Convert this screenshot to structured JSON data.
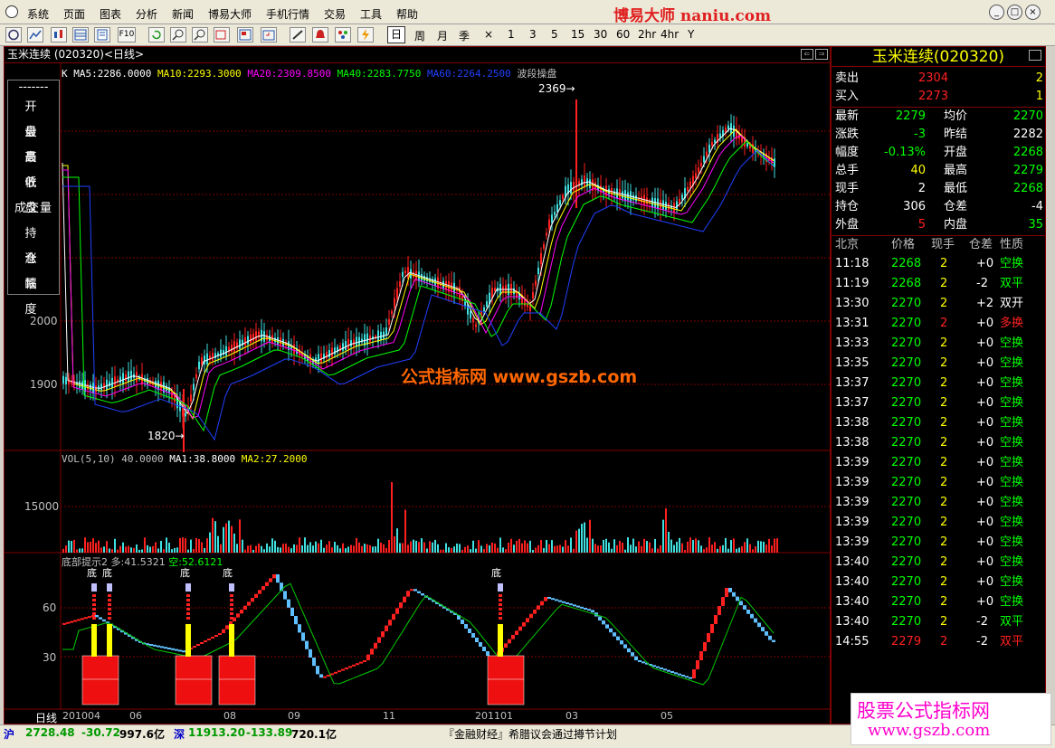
{
  "menu": [
    "系统",
    "页面",
    "图表",
    "分析",
    "新闻",
    "博易大师",
    "手机行情",
    "交易",
    "工具",
    "帮助"
  ],
  "brand": "博易大师 naniu.com",
  "periods": [
    "日",
    "周",
    "月",
    "季",
    "×",
    "1",
    "3",
    "5",
    "15",
    "30",
    "60",
    "2hr",
    "4hr",
    "Y"
  ],
  "chart_title": "玉米连续 (020320)<日线>",
  "ma_legend": {
    "k": "K",
    "ma5": "MA5:2286.0000",
    "ma10": "MA10:2293.3000",
    "ma20": "MA20:2309.8500",
    "ma40": "MA40:2283.7750",
    "ma60": "MA60:2264.2500",
    "extra": "波段操盘"
  },
  "ohlc_labels": [
    "-------",
    "开　盘",
    "最　高",
    "最　低",
    "收　盘",
    "成交量",
    "持　仓",
    "涨　跌",
    "幅　度"
  ],
  "price_axis": [
    "2000",
    "1900"
  ],
  "price_marks": {
    "high": "2369",
    "low": "1820"
  },
  "vol_legend": {
    "vol": "VOL(5,10) 40.0000",
    "ma1": "MA1:38.8000",
    "ma2": "MA2:27.2000"
  },
  "vol_axis": "15000",
  "ind_legend": {
    "name": "底部提示2",
    "duo": "多:41.5321",
    "kong": "空:52.6121"
  },
  "ind_axis": [
    "60",
    "30"
  ],
  "bottom_marks": [
    "底",
    "底",
    "底",
    "底",
    "底"
  ],
  "x_labels": [
    "日线",
    "201004",
    "06",
    "08",
    "09",
    "11",
    "201101",
    "03",
    "05"
  ],
  "watermark": "公式指标网 www.gszb.com",
  "watermark2": {
    "line1": "股票公式指标网",
    "line2": "www.gszb.com"
  },
  "quote": {
    "title": "玉米连续(020320)",
    "sell": {
      "label": "卖出",
      "price": "2304",
      "vol": "2"
    },
    "buy": {
      "label": "买入",
      "price": "2273",
      "vol": "1"
    },
    "rows": [
      {
        "l1": "最新",
        "v1": "2279",
        "l2": "均价",
        "v2": "2270"
      },
      {
        "l1": "涨跌",
        "v1": "-3",
        "l2": "昨结",
        "v2": "2282"
      },
      {
        "l1": "幅度",
        "v1": "-0.13%",
        "l2": "开盘",
        "v2": "2268"
      },
      {
        "l1": "总手",
        "v1": "40",
        "l2": "最高",
        "v2": "2279"
      },
      {
        "l1": "现手",
        "v1": "2",
        "l2": "最低",
        "v2": "2268"
      },
      {
        "l1": "持仓",
        "v1": "306",
        "l2": "仓差",
        "v2": "-4"
      },
      {
        "l1": "外盘",
        "v1": "5",
        "l2": "内盘",
        "v2": "35"
      }
    ],
    "tick_header": [
      "北京",
      "价格",
      "现手",
      "仓差",
      "性质"
    ],
    "ticks": [
      {
        "t": "11:18",
        "p": "2268",
        "v": "2",
        "d": "+0",
        "n": "空换",
        "c": "g"
      },
      {
        "t": "11:19",
        "p": "2268",
        "v": "2",
        "d": "-2",
        "n": "双平",
        "c": "g"
      },
      {
        "t": "13:30",
        "p": "2270",
        "v": "2",
        "d": "+2",
        "n": "双开",
        "c": "w"
      },
      {
        "t": "13:31",
        "p": "2270",
        "v": "2",
        "d": "+0",
        "n": "多换",
        "c": "r"
      },
      {
        "t": "13:33",
        "p": "2270",
        "v": "2",
        "d": "+0",
        "n": "空换",
        "c": "g"
      },
      {
        "t": "13:35",
        "p": "2270",
        "v": "2",
        "d": "+0",
        "n": "空换",
        "c": "g"
      },
      {
        "t": "13:37",
        "p": "2270",
        "v": "2",
        "d": "+0",
        "n": "空换",
        "c": "g"
      },
      {
        "t": "13:37",
        "p": "2270",
        "v": "2",
        "d": "+0",
        "n": "空换",
        "c": "g"
      },
      {
        "t": "13:38",
        "p": "2270",
        "v": "2",
        "d": "+0",
        "n": "空换",
        "c": "g"
      },
      {
        "t": "13:38",
        "p": "2270",
        "v": "2",
        "d": "+0",
        "n": "空换",
        "c": "g"
      },
      {
        "t": "13:39",
        "p": "2270",
        "v": "2",
        "d": "+0",
        "n": "空换",
        "c": "g"
      },
      {
        "t": "13:39",
        "p": "2270",
        "v": "2",
        "d": "+0",
        "n": "空换",
        "c": "g"
      },
      {
        "t": "13:39",
        "p": "2270",
        "v": "2",
        "d": "+0",
        "n": "空换",
        "c": "g"
      },
      {
        "t": "13:39",
        "p": "2270",
        "v": "2",
        "d": "+0",
        "n": "空换",
        "c": "g"
      },
      {
        "t": "13:39",
        "p": "2270",
        "v": "2",
        "d": "+0",
        "n": "空换",
        "c": "g"
      },
      {
        "t": "13:40",
        "p": "2270",
        "v": "2",
        "d": "+0",
        "n": "空换",
        "c": "g"
      },
      {
        "t": "13:40",
        "p": "2270",
        "v": "2",
        "d": "+0",
        "n": "空换",
        "c": "g"
      },
      {
        "t": "13:40",
        "p": "2270",
        "v": "2",
        "d": "+0",
        "n": "空换",
        "c": "g"
      },
      {
        "t": "13:40",
        "p": "2270",
        "v": "2",
        "d": "-2",
        "n": "双平",
        "c": "g"
      },
      {
        "t": "14:55",
        "p": "2279",
        "v": "2",
        "d": "-2",
        "n": "双平",
        "c": "r"
      }
    ]
  },
  "status": {
    "sh": "沪",
    "sh_val": "2728.48",
    "sh_chg": "-30.72",
    "sh_amt": "997.6亿",
    "sz": "深",
    "sz_val": "11913.20",
    "sz_chg": "-133.89",
    "sz_amt": "720.1亿",
    "news": "『金融财经』希腊议会通过撙节计划"
  },
  "colors": {
    "up": "#ff2020",
    "down": "#40e0e0",
    "ma5": "#ffffff",
    "ma10": "#ffff00",
    "ma20": "#ff00ff",
    "ma40": "#00ff00",
    "ma60": "#2040ff"
  }
}
